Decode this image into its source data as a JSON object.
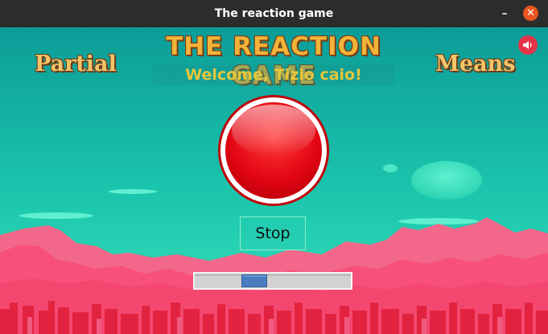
{
  "window": {
    "title": "The reaction game"
  },
  "game": {
    "title": "THE REACTION GAME",
    "welcome": "Welcome, Tizio caio!",
    "left_label": "Partial",
    "right_label": "Means",
    "stop_label": "Stop",
    "slider_value": 0.36,
    "icons": {
      "sound": "speaker-icon",
      "minimize": "minimize-icon",
      "close": "close-icon"
    }
  },
  "colors": {
    "sky_top": "#0f9e9a",
    "sky_bottom": "#2fd9b5",
    "button_red": "#e30613",
    "mountain_pink": "#f5537a",
    "city_red": "#e2233f",
    "title_gold": "#f2b33a",
    "welcome_yellow": "#e8c63a",
    "slider_handle": "#4a7cc0"
  }
}
